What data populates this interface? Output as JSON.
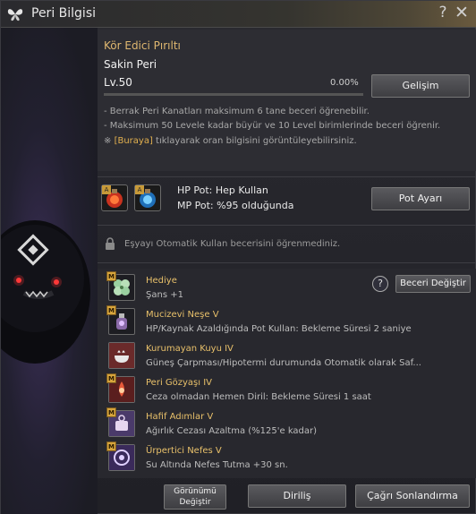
{
  "window": {
    "title": "Peri Bilgisi",
    "help": "?",
    "close": "✕"
  },
  "fairy": {
    "name": "Kör Edici Pırıltı",
    "type": "Sakin Peri",
    "level": "Lv.50",
    "xp_percent": "0.00%",
    "xp_fraction": 0.0,
    "upgrade_button": "Gelişim"
  },
  "descriptions": {
    "line1": "- Berrak Peri Kanatları maksimum 6 tane beceri öğrenebilir.",
    "line2": "- Maksimum 50 Levele kadar büyür ve 10 Level birimlerinde beceri öğrenir.",
    "line3_prefix": "※ ",
    "line3_link": "[Buraya]",
    "line3_suffix": " tıklayarak oran bilgisini görüntüleyebilirsiniz."
  },
  "potions": {
    "hp": "HP Pot: Hep Kullan",
    "mp": "MP Pot: %95 olduğunda",
    "settings_button": "Pot Ayarı",
    "badge": "A"
  },
  "lock": {
    "text": "Eşyayı Otomatik Kullan becerisini öğrenmediniz."
  },
  "skills_header": {
    "change_button": "Beceri Değiştir",
    "help": "?"
  },
  "skills": [
    {
      "badge": "M",
      "name": "Hediye",
      "desc": "Şans +1",
      "icon": "clover-icon"
    },
    {
      "badge": "M",
      "name": "Mucizevi Neşe V",
      "desc": "HP/Kaynak Azaldığında Pot Kullan: Bekleme Süresi 2 saniye",
      "icon": "potion-icon"
    },
    {
      "badge": "",
      "name": "Kurumayan Kuyu IV",
      "desc": "Güneş Çarpması/Hipotermi durumunda Otomatik olarak Saf...",
      "icon": "bowl-icon"
    },
    {
      "badge": "M",
      "name": "Peri Gözyaşı IV",
      "desc": "Ceza olmadan Hemen Diril: Bekleme Süresi 1 saat",
      "icon": "tear-icon"
    },
    {
      "badge": "M",
      "name": "Hafif Adımlar V",
      "desc": "Ağırlık Cezası Azaltma (%125'e kadar)",
      "icon": "weight-icon"
    },
    {
      "badge": "M",
      "name": "Ürpertici Nefes V",
      "desc": "Su Altında Nefes Tutma +30 sn.",
      "icon": "breath-icon"
    }
  ],
  "bottom": {
    "appearance_line1": "Görünümü",
    "appearance_line2": "Değiştir",
    "revive": "Diriliş",
    "end_call": "Çağrı Sonlandırma"
  }
}
